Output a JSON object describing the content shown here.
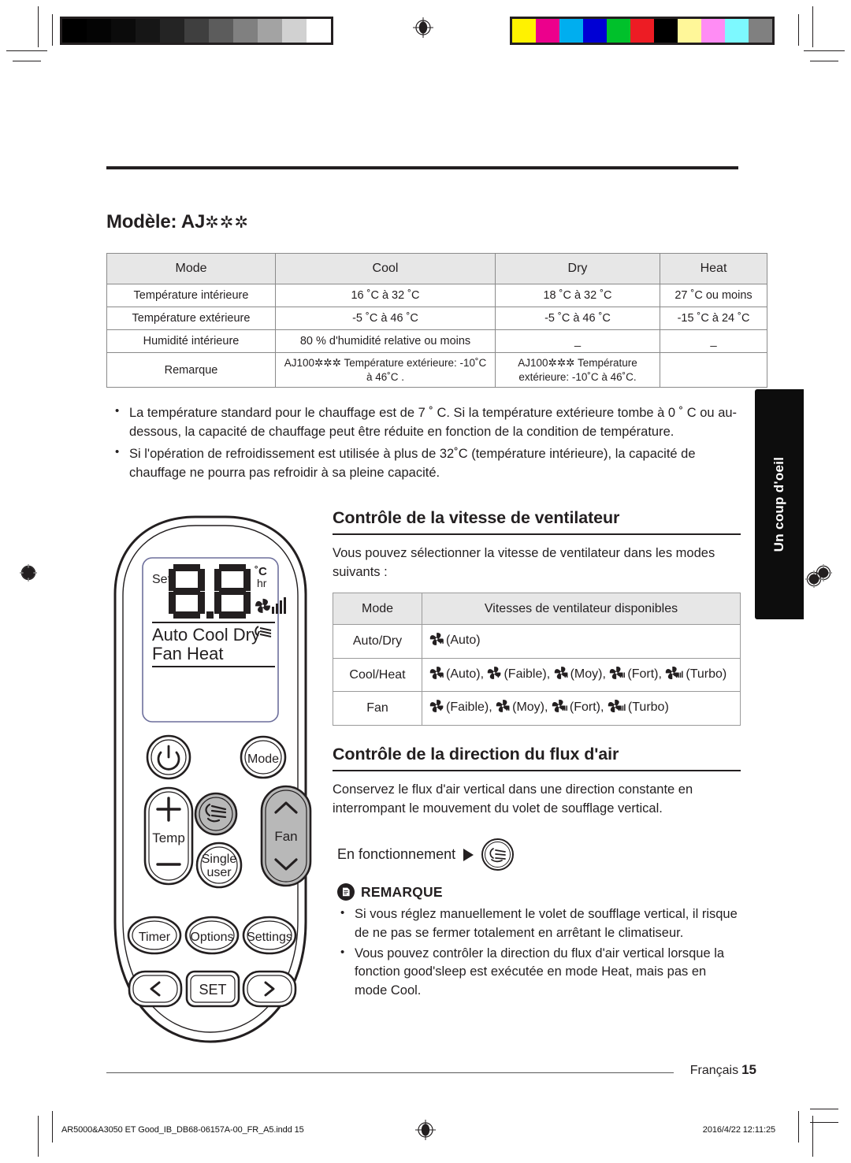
{
  "page": {
    "model_heading": "Modèle: AJ",
    "model_asterisks": "✲✲✲",
    "side_tab": "Un coup d'oeil",
    "footer_language": "Français",
    "footer_page": "15",
    "imprint_file": "AR5000&A3050 ET Good_IB_DB68-06157A-00_FR_A5.indd   15",
    "imprint_date": "2016/4/22   12:11:25"
  },
  "spec_table": {
    "headers": [
      "Mode",
      "Cool",
      "Dry",
      "Heat"
    ],
    "rows": [
      {
        "label": "Température intérieure",
        "cool": "16 ˚C à 32 ˚C",
        "dry": "18 ˚C à 32 ˚C",
        "heat": "27 ˚C ou moins"
      },
      {
        "label": "Température extérieure",
        "cool": "-5 ˚C à 46 ˚C",
        "dry": "-5 ˚C à 46 ˚C",
        "heat": "-15 ˚C à 24 ˚C"
      },
      {
        "label": "Humidité intérieure",
        "cool": "80 % d'humidité relative ou moins",
        "dry": "_",
        "heat": "_"
      },
      {
        "label": "Remarque",
        "cool": "AJ100✲✲✲ Température extérieure: -10˚C à 46˚C .",
        "dry": "AJ100✲✲✲ Température extérieure: -10˚C à 46˚C.",
        "heat": ""
      }
    ]
  },
  "notes_top": [
    "La température standard pour le chauffage est de 7 ˚ C. Si la température extérieure tombe à 0 ˚ C ou au-dessous, la capacité de chauffage peut être réduite en fonction de la condition de température.",
    "Si l'opération de refroidissement est utilisée à plus de 32˚C (température intérieure), la capacité de chauffage ne pourra pas refroidir à sa pleine capacité."
  ],
  "fan_section": {
    "title": "Contrôle de la vitesse de ventilateur",
    "intro": "Vous pouvez sélectionner la vitesse de ventilateur dans les modes suivants :",
    "table": {
      "headers": [
        "Mode",
        "Vitesses de ventilateur disponibles"
      ],
      "rows": [
        {
          "mode": "Auto/Dry",
          "speeds": "(Auto)"
        },
        {
          "mode": "Cool/Heat",
          "speeds": "(Auto),  (Faible),  (Moy),  (Fort),  (Turbo)"
        },
        {
          "mode": "Fan",
          "speeds": "(Faible),  (Moy),  (Fort),  (Turbo)"
        }
      ]
    }
  },
  "airflow_section": {
    "title": "Contrôle de la direction du flux d'air",
    "intro": "Conservez le flux d'air vertical dans une direction constante en interrompant le mouvement du volet de soufflage vertical.",
    "run_label": "En fonctionnement",
    "note_title": "REMARQUE",
    "notes": [
      "Si vous réglez manuellement le volet de soufflage vertical, il risque de ne pas se fermer totalement en arrêtant le climatiseur.",
      "Vous pouvez contrôler la direction du flux d'air vertical lorsque la fonction good'sleep est exécutée en mode Heat, mais pas en mode Cool."
    ]
  },
  "remote": {
    "display": {
      "set": "Set",
      "digits": "8.8",
      "unit_c": "˚C",
      "unit_hr": "hr",
      "modes_line1": "Auto Cool Dry",
      "modes_line2": "Fan  Heat"
    },
    "buttons": [
      {
        "name": "power",
        "label": ""
      },
      {
        "name": "mode",
        "label": "Mode"
      },
      {
        "name": "temp",
        "label": "Temp"
      },
      {
        "name": "swing",
        "label": ""
      },
      {
        "name": "fan",
        "label": "Fan"
      },
      {
        "name": "single-user",
        "label1": "Single",
        "label2": "user"
      },
      {
        "name": "timer",
        "label": "Timer"
      },
      {
        "name": "options",
        "label": "Options"
      },
      {
        "name": "settings",
        "label": "Settings"
      },
      {
        "name": "prev",
        "label": "‹"
      },
      {
        "name": "set",
        "label": "SET"
      },
      {
        "name": "next",
        "label": "›"
      }
    ]
  },
  "prepress": {
    "gray_swatches": [
      "#000000",
      "#040404",
      "#0b0b0b",
      "#161616",
      "#242424",
      "#3f3f3f",
      "#5c5c5c",
      "#808080",
      "#a3a3a3",
      "#d1d1d1",
      "#ffffff"
    ],
    "color_swatches": [
      "#fff200",
      "#ec008c",
      "#00aeef",
      "#0000d4",
      "#00c12b",
      "#ed1c24",
      "#000000",
      "#fff799",
      "#ff8cf4",
      "#7df9ff",
      "#808080"
    ]
  }
}
